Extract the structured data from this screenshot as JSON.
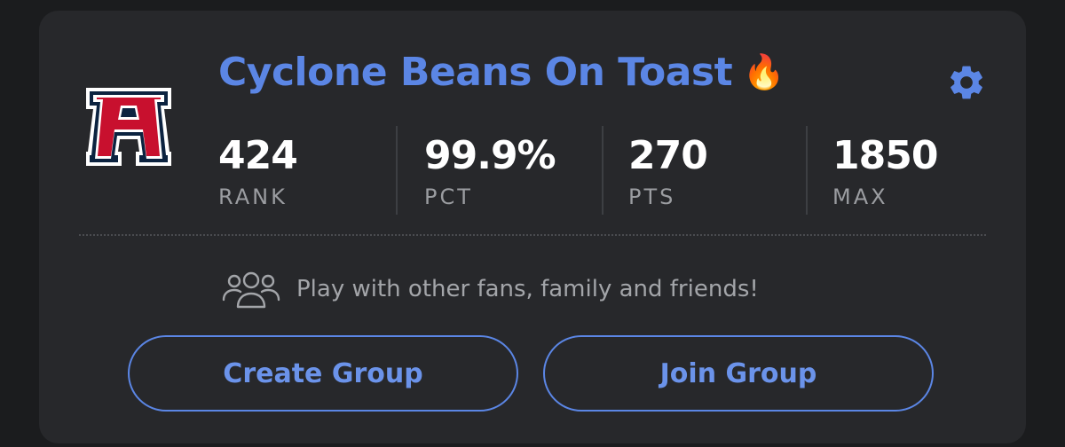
{
  "team": {
    "name": "Cyclone Beans On Toast",
    "emoji": "🔥",
    "logo_letter": "A"
  },
  "stats": [
    {
      "value": "424",
      "label": "RANK"
    },
    {
      "value": "99.9%",
      "label": "PCT"
    },
    {
      "value": "270",
      "label": "PTS"
    },
    {
      "value": "1850",
      "label": "MAX"
    }
  ],
  "invite": {
    "text": "Play with other fans, family and friends!",
    "icon": "group-icon"
  },
  "buttons": {
    "create": "Create Group",
    "join": "Join Group"
  },
  "icons": {
    "settings": "gear-icon"
  },
  "colors": {
    "accent": "#5b86e5",
    "card_bg": "#27282b",
    "page_bg": "#1b1c1e",
    "logo_red": "#c8102e",
    "logo_navy": "#0c2340"
  }
}
